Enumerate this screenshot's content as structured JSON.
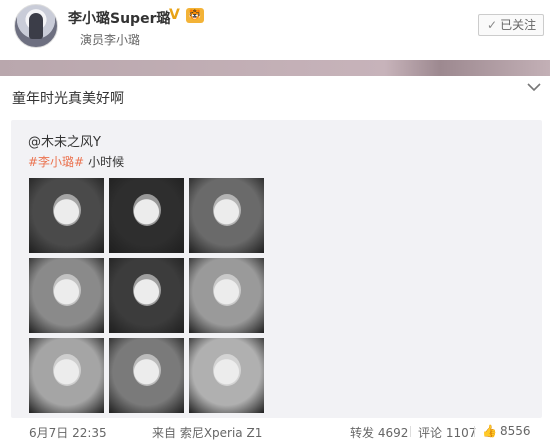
{
  "header": {
    "username": "李小璐Super璐",
    "verified_mark": "V",
    "vip_mark": "🐯",
    "subtitle": "演员李小璐",
    "follow_label": "已关注",
    "follow_check": "✓"
  },
  "post": {
    "text": "童年时光真美好啊",
    "menu_icon": "chevron-down-icon"
  },
  "repost": {
    "author": "@木未之风Y",
    "hashtag": "#李小璐#",
    "text": "小时候",
    "photos": [
      {
        "tone": "#4a4a4a"
      },
      {
        "tone": "#2e2e2e"
      },
      {
        "tone": "#6a6a6a"
      },
      {
        "tone": "#8a8a8a"
      },
      {
        "tone": "#3c3c3c"
      },
      {
        "tone": "#9a9a9a"
      },
      {
        "tone": "#a5a5a5"
      },
      {
        "tone": "#7a7a7a"
      },
      {
        "tone": "#b0b0b0"
      }
    ]
  },
  "footer": {
    "timestamp": "6月7日 22:35",
    "source": "来自 索尼Xperia Z1",
    "reposts": "转发 4692",
    "comments": "评论 1107",
    "likes": "8556",
    "like_icon": "👍"
  }
}
